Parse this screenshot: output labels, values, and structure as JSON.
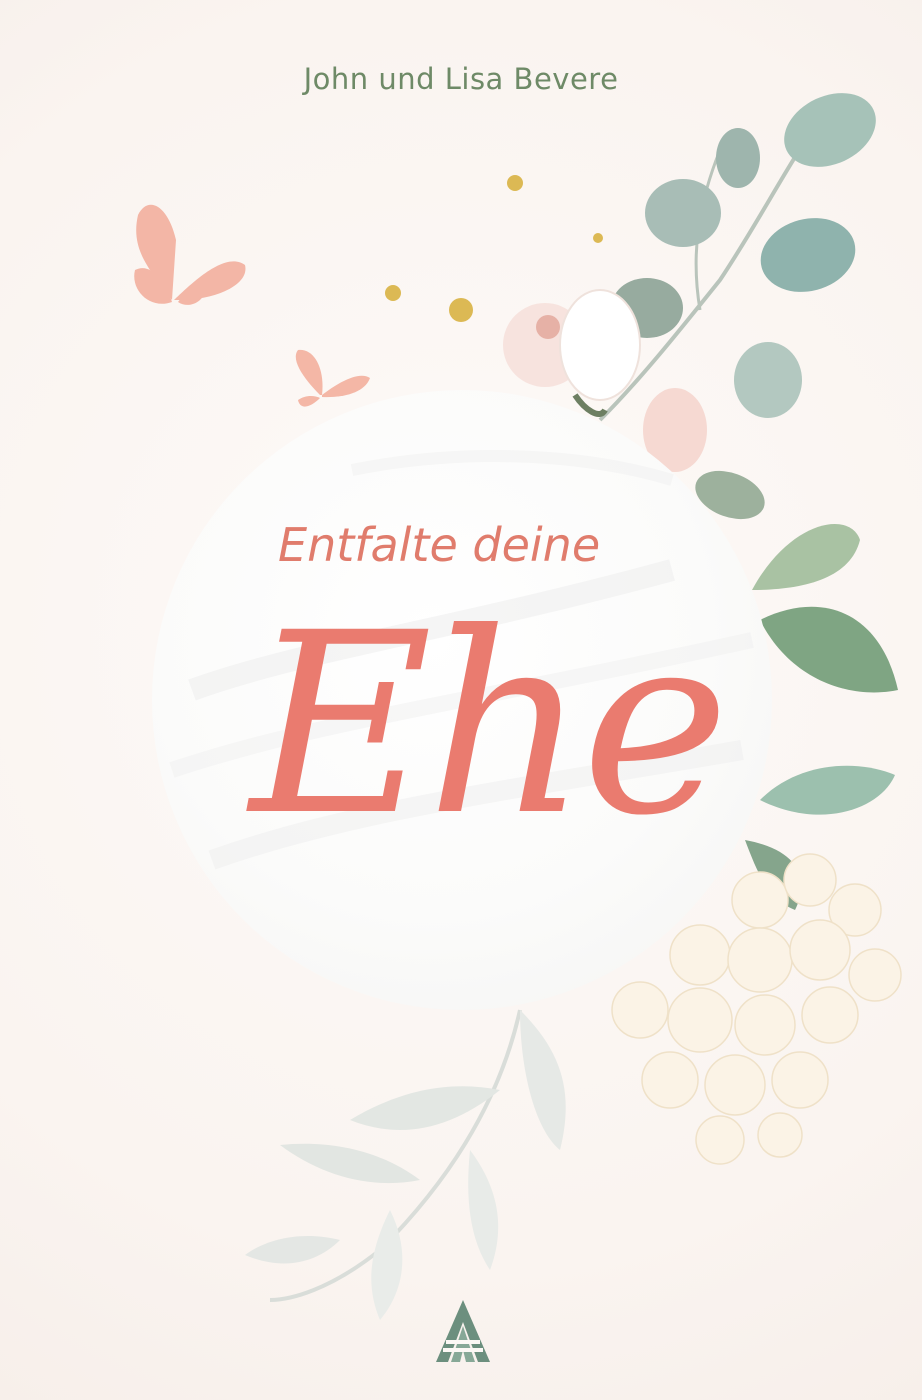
{
  "cover": {
    "authors": "John und Lisa Bevere",
    "subtitle_part1": "Entfalte",
    "subtitle_part2": "deine",
    "title": "Ehe"
  },
  "colors": {
    "background": "#fcf8f5",
    "title": "#ea7b6f",
    "authors": "#6e8a67",
    "leaf_green": "#7fa58a",
    "butterfly": "#f2b3a3",
    "gold": "#d9b54a"
  },
  "icons": {
    "publisher_logo": "triangle-stripes-logo",
    "butterflies": "butterfly-icon",
    "flowers": "flower-icon"
  }
}
